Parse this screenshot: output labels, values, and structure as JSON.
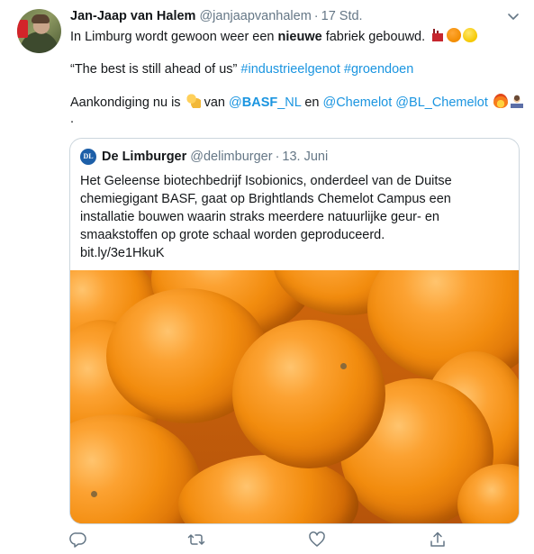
{
  "tweet": {
    "author_name": "Jan-Jaap van Halem",
    "author_handle": "@janjaapvanhalem",
    "separator": "·",
    "time": "17 Std.",
    "line1": {
      "pre": "In Limburg wordt gewoon weer een ",
      "bold": "nieuwe",
      "post": " fabriek gebouwd."
    },
    "line2": {
      "quote": "“The best is still ahead of us” ",
      "hashtag1": "#industrieelgenot",
      "space": " ",
      "hashtag2": "#groendoen"
    },
    "line3": {
      "pre": "Aankondiging nu is ",
      "mid": " van ",
      "mention_basf_at": "@",
      "mention_basf_bold": "BASF",
      "mention_basf_rest": "_NL",
      "en": " en ",
      "mention_chemelot": "@Chemelot",
      "space": " ",
      "mention_bl": "@BL_Chemelot"
    },
    "line4": ".",
    "emojis": [
      "factory-icon",
      "orange-icon",
      "lemon-icon",
      "muscle-icon",
      "fire-icon",
      "technologist-icon"
    ]
  },
  "quoted": {
    "logo_text": "DL",
    "name": "De Limburger",
    "handle": "@delimburger",
    "separator": "·",
    "date": "13. Juni",
    "body_lines": [
      "Het Geleense biotechbedrijf Isobionics, onderdeel van de Duitse",
      "chemiegigant BASF, gaat op Brightlands Chemelot Campus een",
      "installatie bouwen waarin straks meerdere natuurlijke geur- en",
      "smaakstoffen op grote schaal worden geproduceerd.",
      "bit.ly/3e1HkuK"
    ],
    "image": "oranges-photo"
  },
  "actions": [
    "reply-icon",
    "retweet-icon",
    "like-icon",
    "share-icon"
  ],
  "colors": {
    "link": "#1b95e0",
    "secondary_text": "#657786",
    "border": "#ccd6dd"
  }
}
